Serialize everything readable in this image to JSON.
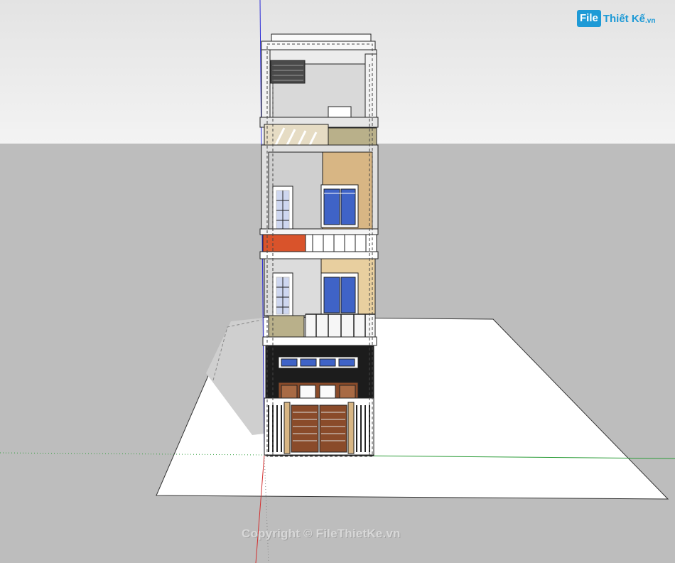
{
  "logo": {
    "box_text": "File",
    "brand_text": "Thiết Kế",
    "domain_text": ".vn"
  },
  "watermark": {
    "copyright_text": "Copyright © FileThietKe.vn"
  },
  "colors": {
    "sky_top": "#e6e6e6",
    "sky_bottom": "#f2f2f2",
    "ground": "#bdbdbd",
    "lot": "#ffffff",
    "axis_blue": "#2b2bd6",
    "axis_red": "#d32f2f",
    "axis_green": "#2e9d3a",
    "window_glass": "#3f63c7",
    "door_wood": "#8a4b2a",
    "balcony_red": "#d9532b",
    "stone": "#b9b08a",
    "wall_tan": "#d8b684"
  }
}
